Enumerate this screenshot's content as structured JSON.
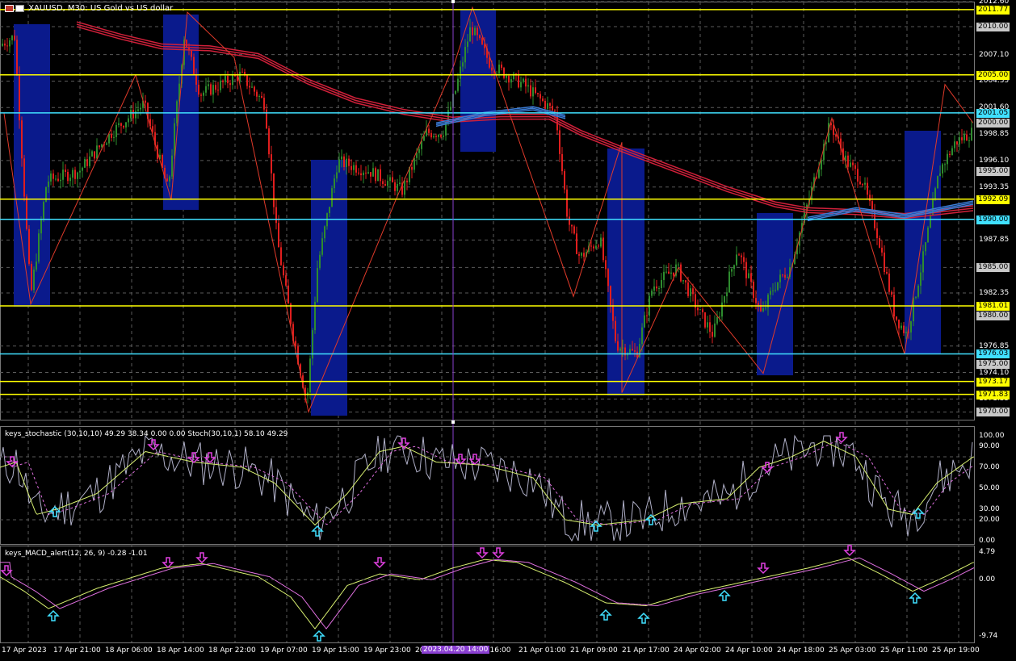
{
  "header": {
    "symbol_text": "XAUUSD, M30:  US Gold vs US dollar",
    "icons": [
      "calendar-icon",
      "bar-chart-icon"
    ]
  },
  "panes": {
    "stoch_title": "keys_stochastic (30,10,10) 49.29 38.34 0.00 0.00 Stoch(30,10,1) 58.10 49.29",
    "macd_title": "keys_MACD_alert(12, 26, 9) -0.28 -1.01"
  },
  "colors": {
    "background": "#000000",
    "yellow_level": "#ffff00",
    "cyan_level": "#40e0ff",
    "bull_candle": "#2e8b2e",
    "bear_candle": "#e01e1e",
    "ma_red": "#d0203a",
    "ma_blue": "#3a7bd5",
    "zone_blue": "#0a1a8c",
    "zigzag": "#e03a2a",
    "arrow_up": "#40e0ff",
    "arrow_down": "#e040e0",
    "grid": "#5a5a5a",
    "highlight": "#8a3fd1"
  },
  "price_axis": [
    "2012.60",
    "2010.00",
    "2007.10",
    "2004.35",
    "2001.60",
    "1998.85",
    "1996.10",
    "1993.35",
    "1987.85",
    "1985.00",
    "1982.35",
    "1976.85",
    "1974.10",
    "1971.35",
    "1970.00"
  ],
  "price_tags": {
    "yellow": [
      "2011.77",
      "2005.00",
      "1992.09",
      "1981.01",
      "1973.17",
      "1971.83"
    ],
    "cyan": [
      "2001.05",
      "1990.00",
      "1976.03"
    ],
    "grey": [
      "2010.00",
      "2000.00",
      "1995.00",
      "1985.00",
      "1980.00",
      "1975.00",
      "1970.00"
    ]
  },
  "stoch_axis": [
    "100.00",
    "90.00",
    "70.00",
    "50.00",
    "30.00",
    "20.00",
    "0.00"
  ],
  "macd_axis": [
    "4.79",
    "0.00",
    "-9.74"
  ],
  "time_axis": [
    "17 Apr 2023",
    "17 Apr 21:00",
    "18 Apr 06:00",
    "18 Apr 14:00",
    "18 Apr 22:00",
    "19 Apr 07:00",
    "19 Apr 15:00",
    "19 Apr 23:00",
    "20",
    "r 16:00",
    "21 Apr 01:00",
    "21 Apr 09:00",
    "21 Apr 17:00",
    "24 Apr 02:00",
    "24 Apr 10:00",
    "24 Apr 18:00",
    "25 Apr 03:00",
    "25 Apr 11:00",
    "25 Apr 19:00"
  ],
  "crosshair_date": "2023.04.20 14:00"
}
